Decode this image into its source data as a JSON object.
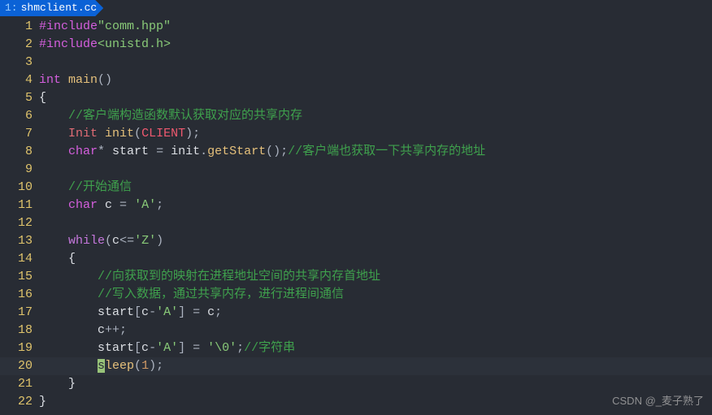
{
  "tab": {
    "index": "1:",
    "filename": "shmclient.cc"
  },
  "watermark": "CSDN @_麦子熟了",
  "lines": [
    {
      "n": "1",
      "cls": "",
      "tokens": [
        {
          "c": "tok-pre",
          "t": "#include"
        },
        {
          "c": "tok-str",
          "t": "\"comm.hpp\""
        }
      ]
    },
    {
      "n": "2",
      "cls": "",
      "tokens": [
        {
          "c": "tok-pre",
          "t": "#include"
        },
        {
          "c": "tok-inc",
          "t": "<unistd.h>"
        }
      ]
    },
    {
      "n": "3",
      "cls": "",
      "tokens": []
    },
    {
      "n": "4",
      "cls": "",
      "tokens": [
        {
          "c": "tok-type",
          "t": "int "
        },
        {
          "c": "tok-fn",
          "t": "main"
        },
        {
          "c": "tok-punc",
          "t": "()"
        }
      ]
    },
    {
      "n": "5",
      "cls": "",
      "tokens": [
        {
          "c": "tok-plain",
          "t": "{"
        }
      ]
    },
    {
      "n": "6",
      "cls": "",
      "tokens": [
        {
          "c": "tok-plain",
          "t": "    "
        },
        {
          "c": "tok-comment-cn",
          "t": "//客户端构造函数默认获取对应的共享内存"
        }
      ]
    },
    {
      "n": "7",
      "cls": "",
      "tokens": [
        {
          "c": "tok-plain",
          "t": "    "
        },
        {
          "c": "tok-id",
          "t": "Init "
        },
        {
          "c": "tok-fn",
          "t": "init"
        },
        {
          "c": "tok-punc",
          "t": "("
        },
        {
          "c": "tok-const",
          "t": "CLIENT"
        },
        {
          "c": "tok-punc",
          "t": ");"
        }
      ]
    },
    {
      "n": "8",
      "cls": "",
      "tokens": [
        {
          "c": "tok-plain",
          "t": "    "
        },
        {
          "c": "tok-type",
          "t": "char"
        },
        {
          "c": "tok-punc",
          "t": "* "
        },
        {
          "c": "tok-var",
          "t": "start"
        },
        {
          "c": "tok-punc",
          "t": " = "
        },
        {
          "c": "tok-var",
          "t": "init"
        },
        {
          "c": "tok-punc",
          "t": "."
        },
        {
          "c": "tok-fn",
          "t": "getStart"
        },
        {
          "c": "tok-punc",
          "t": "();"
        },
        {
          "c": "tok-comment-cn",
          "t": "//客户端也获取一下共享内存的地址"
        }
      ]
    },
    {
      "n": "9",
      "cls": "",
      "tokens": []
    },
    {
      "n": "10",
      "cls": "",
      "tokens": [
        {
          "c": "tok-plain",
          "t": "    "
        },
        {
          "c": "tok-comment-cn",
          "t": "//开始通信"
        }
      ]
    },
    {
      "n": "11",
      "cls": "",
      "tokens": [
        {
          "c": "tok-plain",
          "t": "    "
        },
        {
          "c": "tok-type",
          "t": "char "
        },
        {
          "c": "tok-var",
          "t": "c"
        },
        {
          "c": "tok-punc",
          "t": " = "
        },
        {
          "c": "tok-char",
          "t": "'A'"
        },
        {
          "c": "tok-punc",
          "t": ";"
        }
      ]
    },
    {
      "n": "12",
      "cls": "",
      "tokens": []
    },
    {
      "n": "13",
      "cls": "",
      "tokens": [
        {
          "c": "tok-plain",
          "t": "    "
        },
        {
          "c": "tok-kw",
          "t": "while"
        },
        {
          "c": "tok-punc",
          "t": "("
        },
        {
          "c": "tok-var",
          "t": "c"
        },
        {
          "c": "tok-punc",
          "t": "<="
        },
        {
          "c": "tok-char",
          "t": "'Z'"
        },
        {
          "c": "tok-punc",
          "t": ")"
        }
      ]
    },
    {
      "n": "14",
      "cls": "",
      "tokens": [
        {
          "c": "tok-plain",
          "t": "    {"
        }
      ]
    },
    {
      "n": "15",
      "cls": "",
      "tokens": [
        {
          "c": "tok-plain",
          "t": "        "
        },
        {
          "c": "tok-comment-cn",
          "t": "//向获取到的映射在进程地址空间的共享内存首地址"
        }
      ]
    },
    {
      "n": "16",
      "cls": "",
      "tokens": [
        {
          "c": "tok-plain",
          "t": "        "
        },
        {
          "c": "tok-comment-cn",
          "t": "//写入数据，通过共享内存，进行进程间通信"
        }
      ]
    },
    {
      "n": "17",
      "cls": "",
      "tokens": [
        {
          "c": "tok-plain",
          "t": "        "
        },
        {
          "c": "tok-var",
          "t": "start"
        },
        {
          "c": "tok-punc",
          "t": "["
        },
        {
          "c": "tok-var",
          "t": "c"
        },
        {
          "c": "tok-punc",
          "t": "-"
        },
        {
          "c": "tok-char",
          "t": "'A'"
        },
        {
          "c": "tok-punc",
          "t": "] = "
        },
        {
          "c": "tok-var",
          "t": "c"
        },
        {
          "c": "tok-punc",
          "t": ";"
        }
      ]
    },
    {
      "n": "18",
      "cls": "",
      "tokens": [
        {
          "c": "tok-plain",
          "t": "        "
        },
        {
          "c": "tok-var",
          "t": "c"
        },
        {
          "c": "tok-punc",
          "t": "++;"
        }
      ]
    },
    {
      "n": "19",
      "cls": "",
      "tokens": [
        {
          "c": "tok-plain",
          "t": "        "
        },
        {
          "c": "tok-var",
          "t": "start"
        },
        {
          "c": "tok-punc",
          "t": "["
        },
        {
          "c": "tok-var",
          "t": "c"
        },
        {
          "c": "tok-punc",
          "t": "-"
        },
        {
          "c": "tok-char",
          "t": "'A'"
        },
        {
          "c": "tok-punc",
          "t": "] = "
        },
        {
          "c": "tok-char",
          "t": "'\\0'"
        },
        {
          "c": "tok-punc",
          "t": ";"
        },
        {
          "c": "tok-comment-cn",
          "t": "//字符串"
        }
      ]
    },
    {
      "n": "20",
      "cls": "cursor",
      "tokens": [
        {
          "c": "tok-plain",
          "t": "        "
        },
        {
          "c": "cursor-block",
          "t": "s"
        },
        {
          "c": "tok-fn",
          "t": "leep"
        },
        {
          "c": "tok-punc",
          "t": "("
        },
        {
          "c": "tok-num",
          "t": "1"
        },
        {
          "c": "tok-punc",
          "t": ");"
        }
      ]
    },
    {
      "n": "21",
      "cls": "",
      "tokens": [
        {
          "c": "tok-plain",
          "t": "    }"
        }
      ]
    },
    {
      "n": "22",
      "cls": "",
      "tokens": [
        {
          "c": "tok-plain",
          "t": "}"
        }
      ]
    }
  ]
}
